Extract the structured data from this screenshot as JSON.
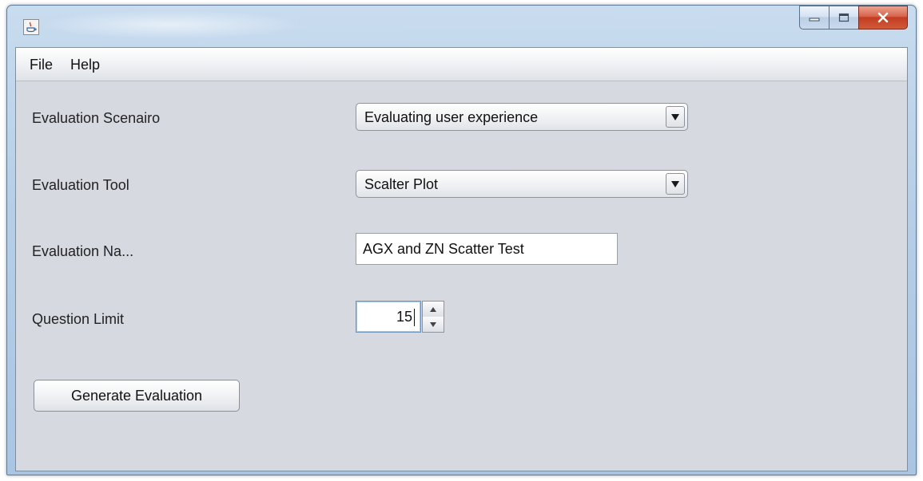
{
  "menu": {
    "file": "File",
    "help": "Help"
  },
  "form": {
    "scenario_label": "Evaluation Scenairo",
    "scenario_value": "Evaluating user experience",
    "tool_label": "Evaluation Tool",
    "tool_value": "Scalter Plot",
    "name_label": "Evaluation Na...",
    "name_value": "AGX and ZN Scatter Test",
    "limit_label": "Question Limit",
    "limit_value": "15"
  },
  "actions": {
    "generate_label": "Generate Evaluation"
  },
  "icons": {
    "app": "java-cup-icon",
    "minimize": "minimize-icon",
    "maximize": "maximize-icon",
    "close": "close-icon",
    "dropdown": "chevron-down-icon",
    "spin_up": "spin-up-icon",
    "spin_down": "spin-down-icon"
  },
  "colors": {
    "close_button": "#c94a2f",
    "title_bar": "#b7cfe7",
    "panel": "#d6d9df"
  }
}
